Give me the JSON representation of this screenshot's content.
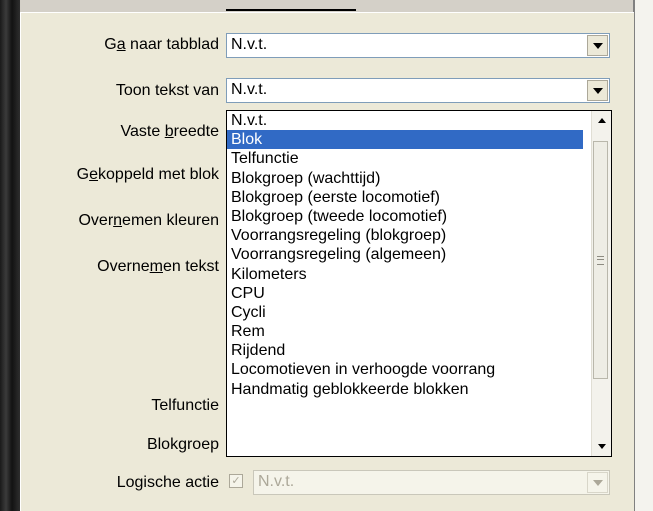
{
  "fields": {
    "tab": {
      "label_pre": "G",
      "label_u": "a",
      "label_post": " naar tabblad",
      "value": "N.v.t."
    },
    "text_of": {
      "label": "Toon tekst van",
      "value": "N.v.t."
    },
    "fixed_width": {
      "label_pre": "Vaste ",
      "label_u": "b",
      "label_post": "reedte"
    },
    "linked_block": {
      "label_pre": "G",
      "label_u": "e",
      "label_post": "koppeld met blok"
    },
    "take_colors": {
      "label_pre": "Over",
      "label_u": "n",
      "label_post": "emen kleuren"
    },
    "take_text": {
      "label_pre": "Overne",
      "label_u": "m",
      "label_post": "en tekst"
    },
    "counter": {
      "label": "Telfunctie"
    },
    "blockgroup": {
      "label": "Blokgroep"
    },
    "logic_action": {
      "label": "Logische actie",
      "checked": true,
      "value": "N.v.t."
    }
  },
  "dropdown_options": [
    "N.v.t.",
    "Blok",
    "Telfunctie",
    "Blokgroep (wachttijd)",
    "Blokgroep (eerste locomotief)",
    "Blokgroep (tweede locomotief)",
    "Voorrangsregeling (blokgroep)",
    "Voorrangsregeling (algemeen)",
    "Kilometers",
    "CPU",
    "Cycli",
    "Rem",
    "Rijdend",
    "Locomotieven in verhoogde voorrang",
    "Handmatig geblokkeerde blokken"
  ],
  "selected_option": "Blok",
  "colors": {
    "selection": "#316ac5",
    "panel": "#ece9d8",
    "border": "#7f9db9"
  }
}
